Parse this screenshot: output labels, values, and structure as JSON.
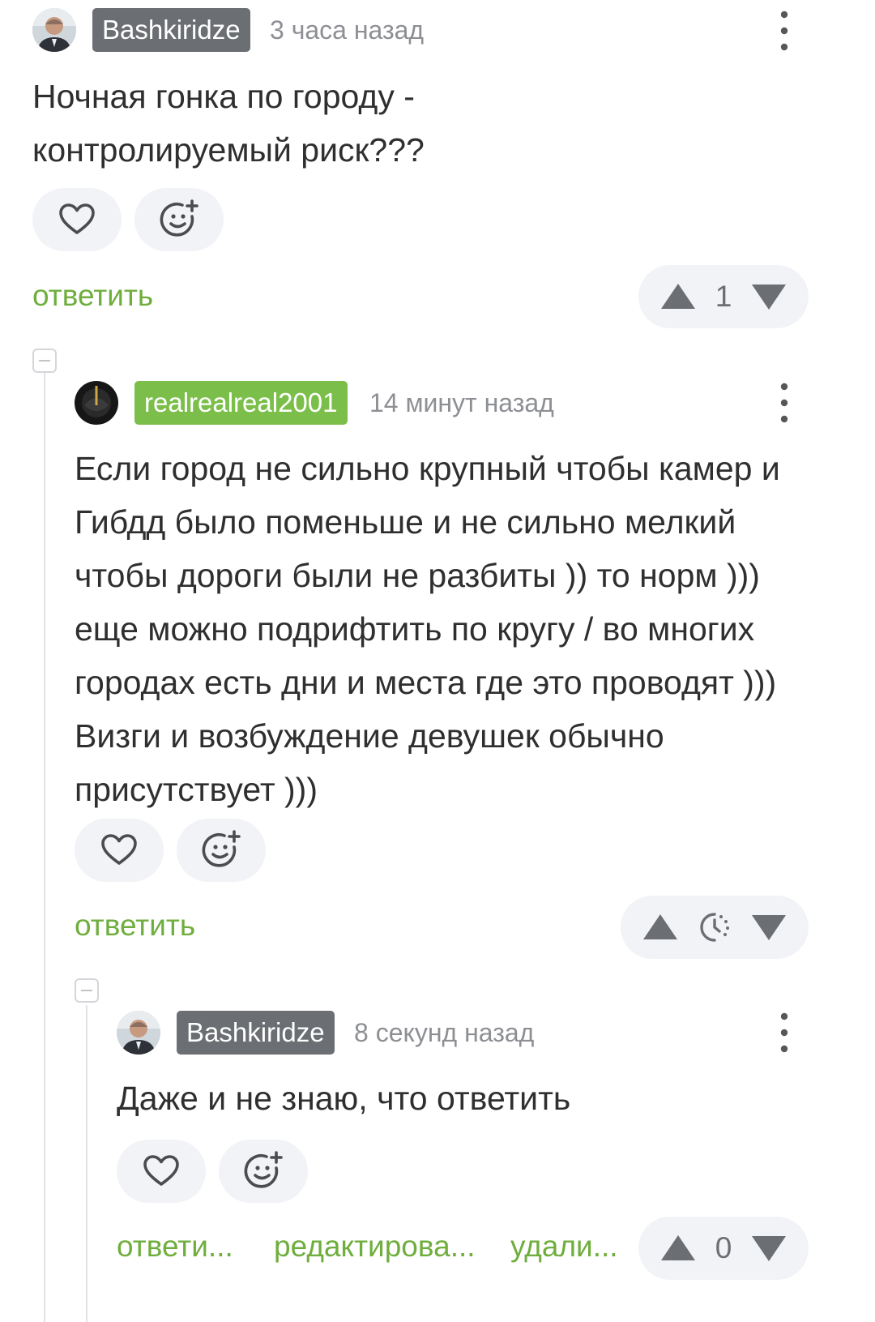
{
  "comments": [
    {
      "author": "Bashkiridze",
      "time": "3 часа назад",
      "lines": [
        "Ночная гонка по городу -",
        "контролируемый риск???"
      ],
      "reply_label": "ответить",
      "score": "1"
    },
    {
      "author": "realrealreal2001",
      "time": "14 минут назад",
      "lines": [
        "Если город не сильно крупный чтобы камер и",
        "Гибдд было поменьше и не сильно мелкий",
        "чтобы дороги были не разбиты )) то норм )))",
        "еще можно подрифтить по кругу / во многих",
        "городах есть дни и места где это проводят )))",
        "Визги и возбуждение девушек обычно",
        "присутствует )))"
      ],
      "reply_label": "ответить"
    },
    {
      "author": "Bashkiridze",
      "time": "8 секунд назад",
      "lines": [
        "Даже и не знаю, что ответить"
      ],
      "reply_label": "ответи...",
      "edit_label": "редактирова...",
      "delete_label": "удали...",
      "score": "0"
    }
  ],
  "colors": {
    "green": "#6fae3d",
    "badge_gray": "#6b6e73",
    "badge_green": "#7bbf4a",
    "pill_bg": "#f2f3f6"
  }
}
